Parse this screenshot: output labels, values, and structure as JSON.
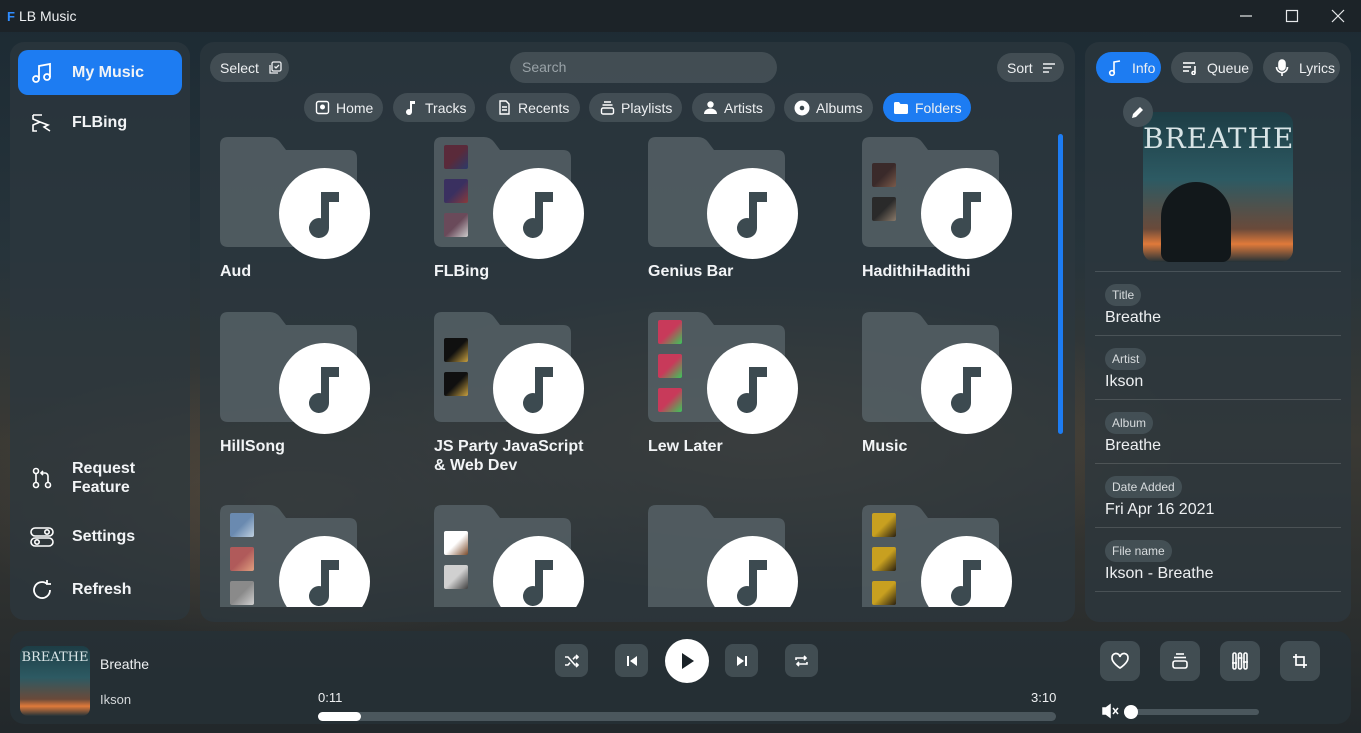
{
  "app": {
    "logo": "F",
    "title": "LB Music"
  },
  "window_controls": [
    "minimize-icon",
    "maximize-icon",
    "close-icon"
  ],
  "sidebar": {
    "items": [
      {
        "label": "My Music",
        "icon": "music-notes-icon",
        "active": true
      },
      {
        "label": "FLBing",
        "icon": "flbing-logo-icon",
        "active": false
      }
    ],
    "bottom_items": [
      {
        "label": "Request Feature",
        "label_line1": "Request",
        "label_line2": "Feature",
        "icon": "pull-request-icon"
      },
      {
        "label": "Settings",
        "icon": "toggles-icon"
      },
      {
        "label": "Refresh",
        "icon": "refresh-icon"
      }
    ]
  },
  "toolbar": {
    "select_label": "Select",
    "search_placeholder": "Search",
    "sort_label": "Sort"
  },
  "filters": [
    {
      "label": "Home",
      "icon": "home-icon",
      "active": false
    },
    {
      "label": "Tracks",
      "icon": "music-note-icon",
      "active": false
    },
    {
      "label": "Recents",
      "icon": "document-icon",
      "active": false
    },
    {
      "label": "Playlists",
      "icon": "playlist-icon",
      "active": false
    },
    {
      "label": "Artists",
      "icon": "person-icon",
      "active": false
    },
    {
      "label": "Albums",
      "icon": "disc-icon",
      "active": false
    },
    {
      "label": "Folders",
      "icon": "folder-icon",
      "active": true
    }
  ],
  "folders": [
    {
      "name": "Aud"
    },
    {
      "name": "FLBing"
    },
    {
      "name": "Genius Bar"
    },
    {
      "name": "HadithiHadithi"
    },
    {
      "name": "HillSong"
    },
    {
      "name": "JS Party JavaScript & Web Dev",
      "name_line1": "JS Party JavaScript",
      "name_line2": "& Web Dev"
    },
    {
      "name": "Lew Later"
    },
    {
      "name": "Music"
    },
    {
      "name": ""
    },
    {
      "name": ""
    },
    {
      "name": ""
    },
    {
      "name": ""
    }
  ],
  "right_panel": {
    "tabs": [
      {
        "label": "Info",
        "icon": "music-note-icon",
        "active": true
      },
      {
        "label": "Queue",
        "icon": "queue-icon",
        "active": false
      },
      {
        "label": "Lyrics",
        "icon": "microphone-icon",
        "active": false
      }
    ],
    "album_art_text": "BREATHE",
    "edit_icon": "pencil-icon",
    "fields": [
      {
        "label": "Title",
        "value": "Breathe"
      },
      {
        "label": "Artist",
        "value": "Ikson"
      },
      {
        "label": "Album",
        "value": "Breathe"
      },
      {
        "label": "Date Added",
        "value": "Fri Apr 16 2021"
      },
      {
        "label": "File name",
        "value": "Ikson - Breathe"
      }
    ]
  },
  "player": {
    "title": "Breathe",
    "artist": "Ikson",
    "art_text": "BREATHE",
    "elapsed": "0:11",
    "duration": "3:10",
    "progress_fraction": 0.058,
    "volume_fraction": 0.0,
    "controls": [
      "shuffle-icon",
      "previous-icon",
      "play-icon",
      "next-icon",
      "repeat-icon"
    ],
    "actions": [
      "heart-icon",
      "playlist-add-icon",
      "equalizer-icon",
      "crop-icon"
    ]
  },
  "colors": {
    "accent": "#1d7cf2",
    "panel": "#2c383e"
  }
}
